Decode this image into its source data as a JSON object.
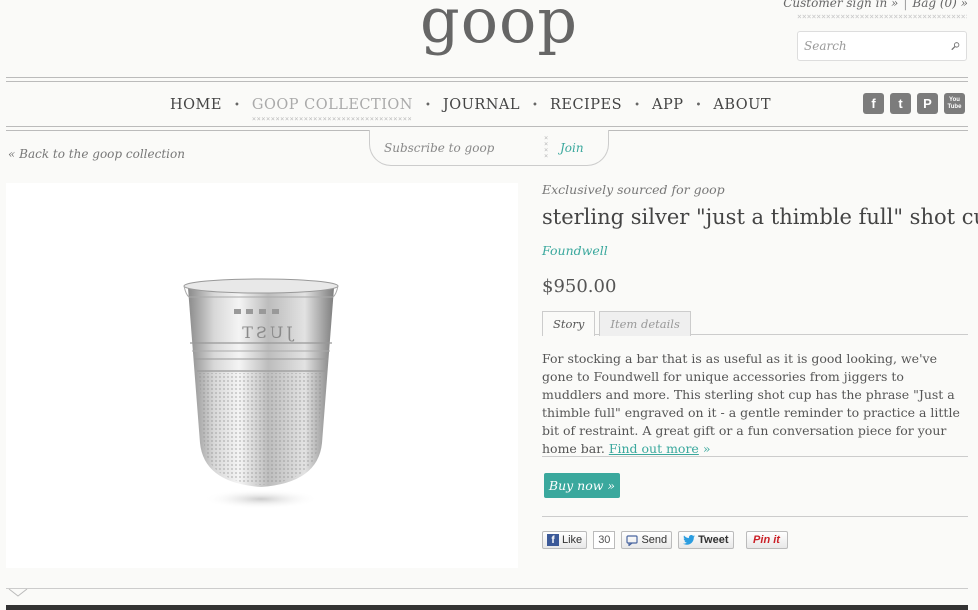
{
  "header": {
    "logo": "goop",
    "account": {
      "sign_in": "Customer sign in »",
      "separator": "|",
      "bag": "Bag (0) »"
    },
    "search_placeholder": "Search",
    "dots": "×××××××××××××××××××××××××××××××××××××"
  },
  "nav": {
    "items": [
      {
        "label": "HOME",
        "active": false
      },
      {
        "label": "GOOP COLLECTION",
        "active": true
      },
      {
        "label": "JOURNAL",
        "active": false
      },
      {
        "label": "RECIPES",
        "active": false
      },
      {
        "label": "APP",
        "active": false
      },
      {
        "label": "ABOUT",
        "active": false
      }
    ],
    "separator": "•",
    "active_dots": "××××××××××××××××××××××××××××××××××"
  },
  "social": {
    "facebook": "f",
    "twitter": "t",
    "pinterest": "P",
    "youtube_top": "You",
    "youtube_bottom": "Tube"
  },
  "subscribe": {
    "placeholder": "Subscribe to goop",
    "button": "Join",
    "sep": "× × × ×"
  },
  "back_link": "« Back to the goop collection",
  "product": {
    "sourced": "Exclusively sourced for goop",
    "title": "sterling silver \"just a thimble full\" shot cup",
    "brand": "Foundwell",
    "price": "$950.00",
    "tabs": [
      "Story",
      "Item details"
    ],
    "story": "For stocking a bar that is as useful as it is good looking, we've gone to Foundwell for unique accessories from jiggers to muddlers and more. This sterling shot cup has the phrase \"Just a thimble full\" engraved on it - a gentle reminder to practice a little bit of restraint. A great gift or a fun conversation piece for your home bar. ",
    "find_out_more": "Find out more",
    "find_out_more_arrow": " »",
    "engraving": "JUST",
    "buy_now": "Buy now »"
  },
  "share": {
    "like": "Like",
    "like_count": "30",
    "send": "Send",
    "tweet": "Tweet",
    "pin": "Pin it"
  },
  "colors": {
    "accent": "#3aa89d",
    "text": "#555555",
    "social_gray": "#7c7c7c",
    "facebook_blue": "#3b5998"
  }
}
